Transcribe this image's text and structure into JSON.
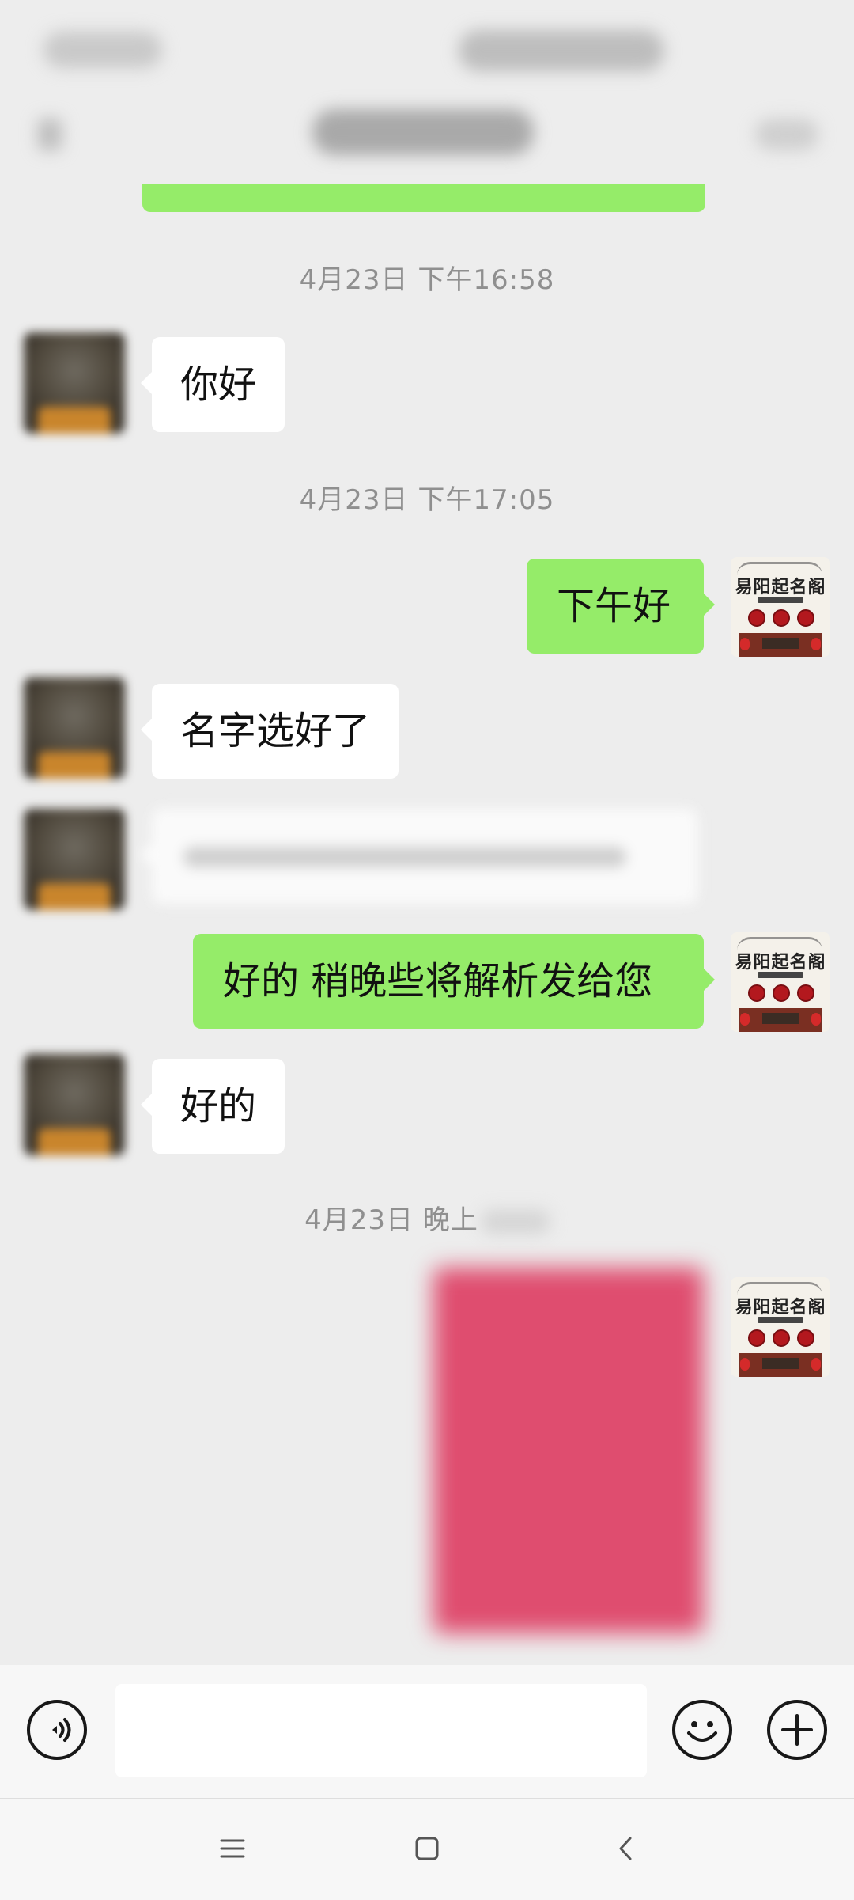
{
  "messages": [
    {
      "type": "timestamp",
      "text": "4月23日 下午16:58"
    },
    {
      "type": "incoming",
      "text": "你好"
    },
    {
      "type": "timestamp",
      "text": "4月23日 下午17:05"
    },
    {
      "type": "outgoing",
      "text": "下午好"
    },
    {
      "type": "incoming",
      "text": "名字选好了"
    },
    {
      "type": "incoming",
      "text": "",
      "blurred": true
    },
    {
      "type": "outgoing",
      "text": "好的 稍晚些将解析发给您"
    },
    {
      "type": "incoming",
      "text": "好的"
    },
    {
      "type": "timestamp",
      "text": "4月23日 晚上"
    },
    {
      "type": "outgoing_image",
      "blurred": true,
      "color": "#df4d6f"
    }
  ],
  "contact_avatar": {
    "icon": "profile-photo"
  },
  "my_avatar": {
    "logo_text": "易阳起名阁"
  },
  "input_bar": {
    "voice_icon": "voice-icon",
    "emoji_icon": "emoji-icon",
    "plus_icon": "plus-icon",
    "placeholder": ""
  },
  "nav_bar": {
    "menu_icon": "menu-icon",
    "home_icon": "home-icon",
    "back_icon": "back-icon"
  },
  "colors": {
    "bg": "#ededed",
    "outgoing": "#95ec69",
    "incoming": "#ffffff"
  }
}
